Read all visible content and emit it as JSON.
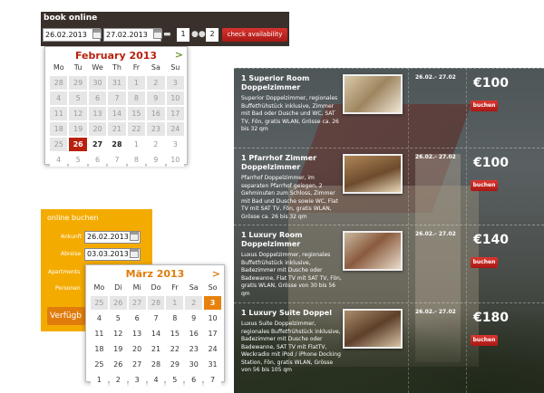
{
  "book_online": {
    "title": "book online",
    "arrival": "26.02.2013",
    "departure": "27.02.2013",
    "rooms": "1",
    "persons": "2",
    "check_label": "check availability",
    "bed_icon": "bed-icon",
    "persons_icon": "persons-icon"
  },
  "feb_calendar": {
    "month": "February 2013",
    "next": ">",
    "weekdays": [
      "Mo",
      "Tu",
      "We",
      "Th",
      "Fr",
      "Sa",
      "Su"
    ],
    "days": [
      "28",
      "29",
      "30",
      "31",
      "1",
      "2",
      "3",
      "4",
      "5",
      "6",
      "7",
      "8",
      "9",
      "10",
      "11",
      "12",
      "13",
      "14",
      "15",
      "16",
      "17",
      "18",
      "19",
      "20",
      "21",
      "22",
      "23",
      "24",
      "25",
      "26",
      "27",
      "28",
      "1",
      "2",
      "3",
      "4",
      "5",
      "6",
      "7",
      "8",
      "9",
      "10"
    ]
  },
  "online_buchen": {
    "title": "online buchen",
    "ankunft_label": "Ankunft",
    "ankunft": "26.02.2013",
    "abreise_label": "Abreise",
    "abreise": "03.03.2013",
    "apartments_label": "Apartments",
    "personen_label": "Personen",
    "button": "Verfügb"
  },
  "maerz_calendar": {
    "month": "März 2013",
    "next": ">",
    "weekdays": [
      "Mo",
      "Di",
      "Mi",
      "Do",
      "Fr",
      "Sa",
      "So"
    ],
    "days": [
      "25",
      "26",
      "27",
      "28",
      "1",
      "2",
      "3",
      "4",
      "5",
      "6",
      "7",
      "8",
      "9",
      "10",
      "11",
      "12",
      "13",
      "14",
      "15",
      "16",
      "17",
      "18",
      "19",
      "20",
      "21",
      "22",
      "23",
      "24",
      "25",
      "26",
      "27",
      "28",
      "29",
      "30",
      "31",
      "1",
      "2",
      "3",
      "4",
      "5",
      "6",
      "7"
    ]
  },
  "rooms": [
    {
      "title": "1 Superior Room Doppelzimmer",
      "desc": "Superior Doppelzimmer, regionales Buffetfrühstück inklusive, Zimmer mit Bad oder Dusche und WC, SAT TV, Fön, gratis WLAN, Grösse ca. 26 bis 32 qm",
      "dates": "26.02.- 27.02",
      "price": "€100",
      "button": "buchen"
    },
    {
      "title": "1 Pfarrhof Zimmer Doppelzimmer",
      "desc": "Pfarrhof Doppelzimmer, im separaten Pfarrhof gelegen, 2 Gehminuten zum Schloss, Zimmer mit Bad und Dusche sowie WC, Flat TV mit SAT TV, Fön, gratis WLAN, Grösse ca. 26 bis 32 qm",
      "dates": "26.02.- 27.02",
      "price": "€100",
      "button": "buchen"
    },
    {
      "title": "1 Luxury Room Doppelzimmer",
      "desc": "Luxus Doppelzimmer, regionales Buffetfrühstück inklusive, Badezimmer mit Dusche oder Badewanne, Flat TV mit SAT TV, Fön, gratis WLAN, Grösse von 30 bis 56 qm",
      "dates": "26.02.- 27.02",
      "price": "€140",
      "button": "buchen"
    },
    {
      "title": "1 Luxury Suite Doppel",
      "desc": "Luxus Suite Doppelzimmer, regionales Buffetfrühstück inklusive, Badezimmer mit Dusche oder Badewanne, SAT TV mit FlatTV, Weckradio mit iPod / iPhone Docking Station, Fön, gratis WLAN, Grösse von 56 bis 105 qm",
      "dates": "26.02.- 27.02",
      "price": "€180",
      "button": "buchen"
    }
  ],
  "colors": {
    "accent_red": "#b8210f",
    "orange": "#f4ab00",
    "dark_header": "#3a302b"
  }
}
